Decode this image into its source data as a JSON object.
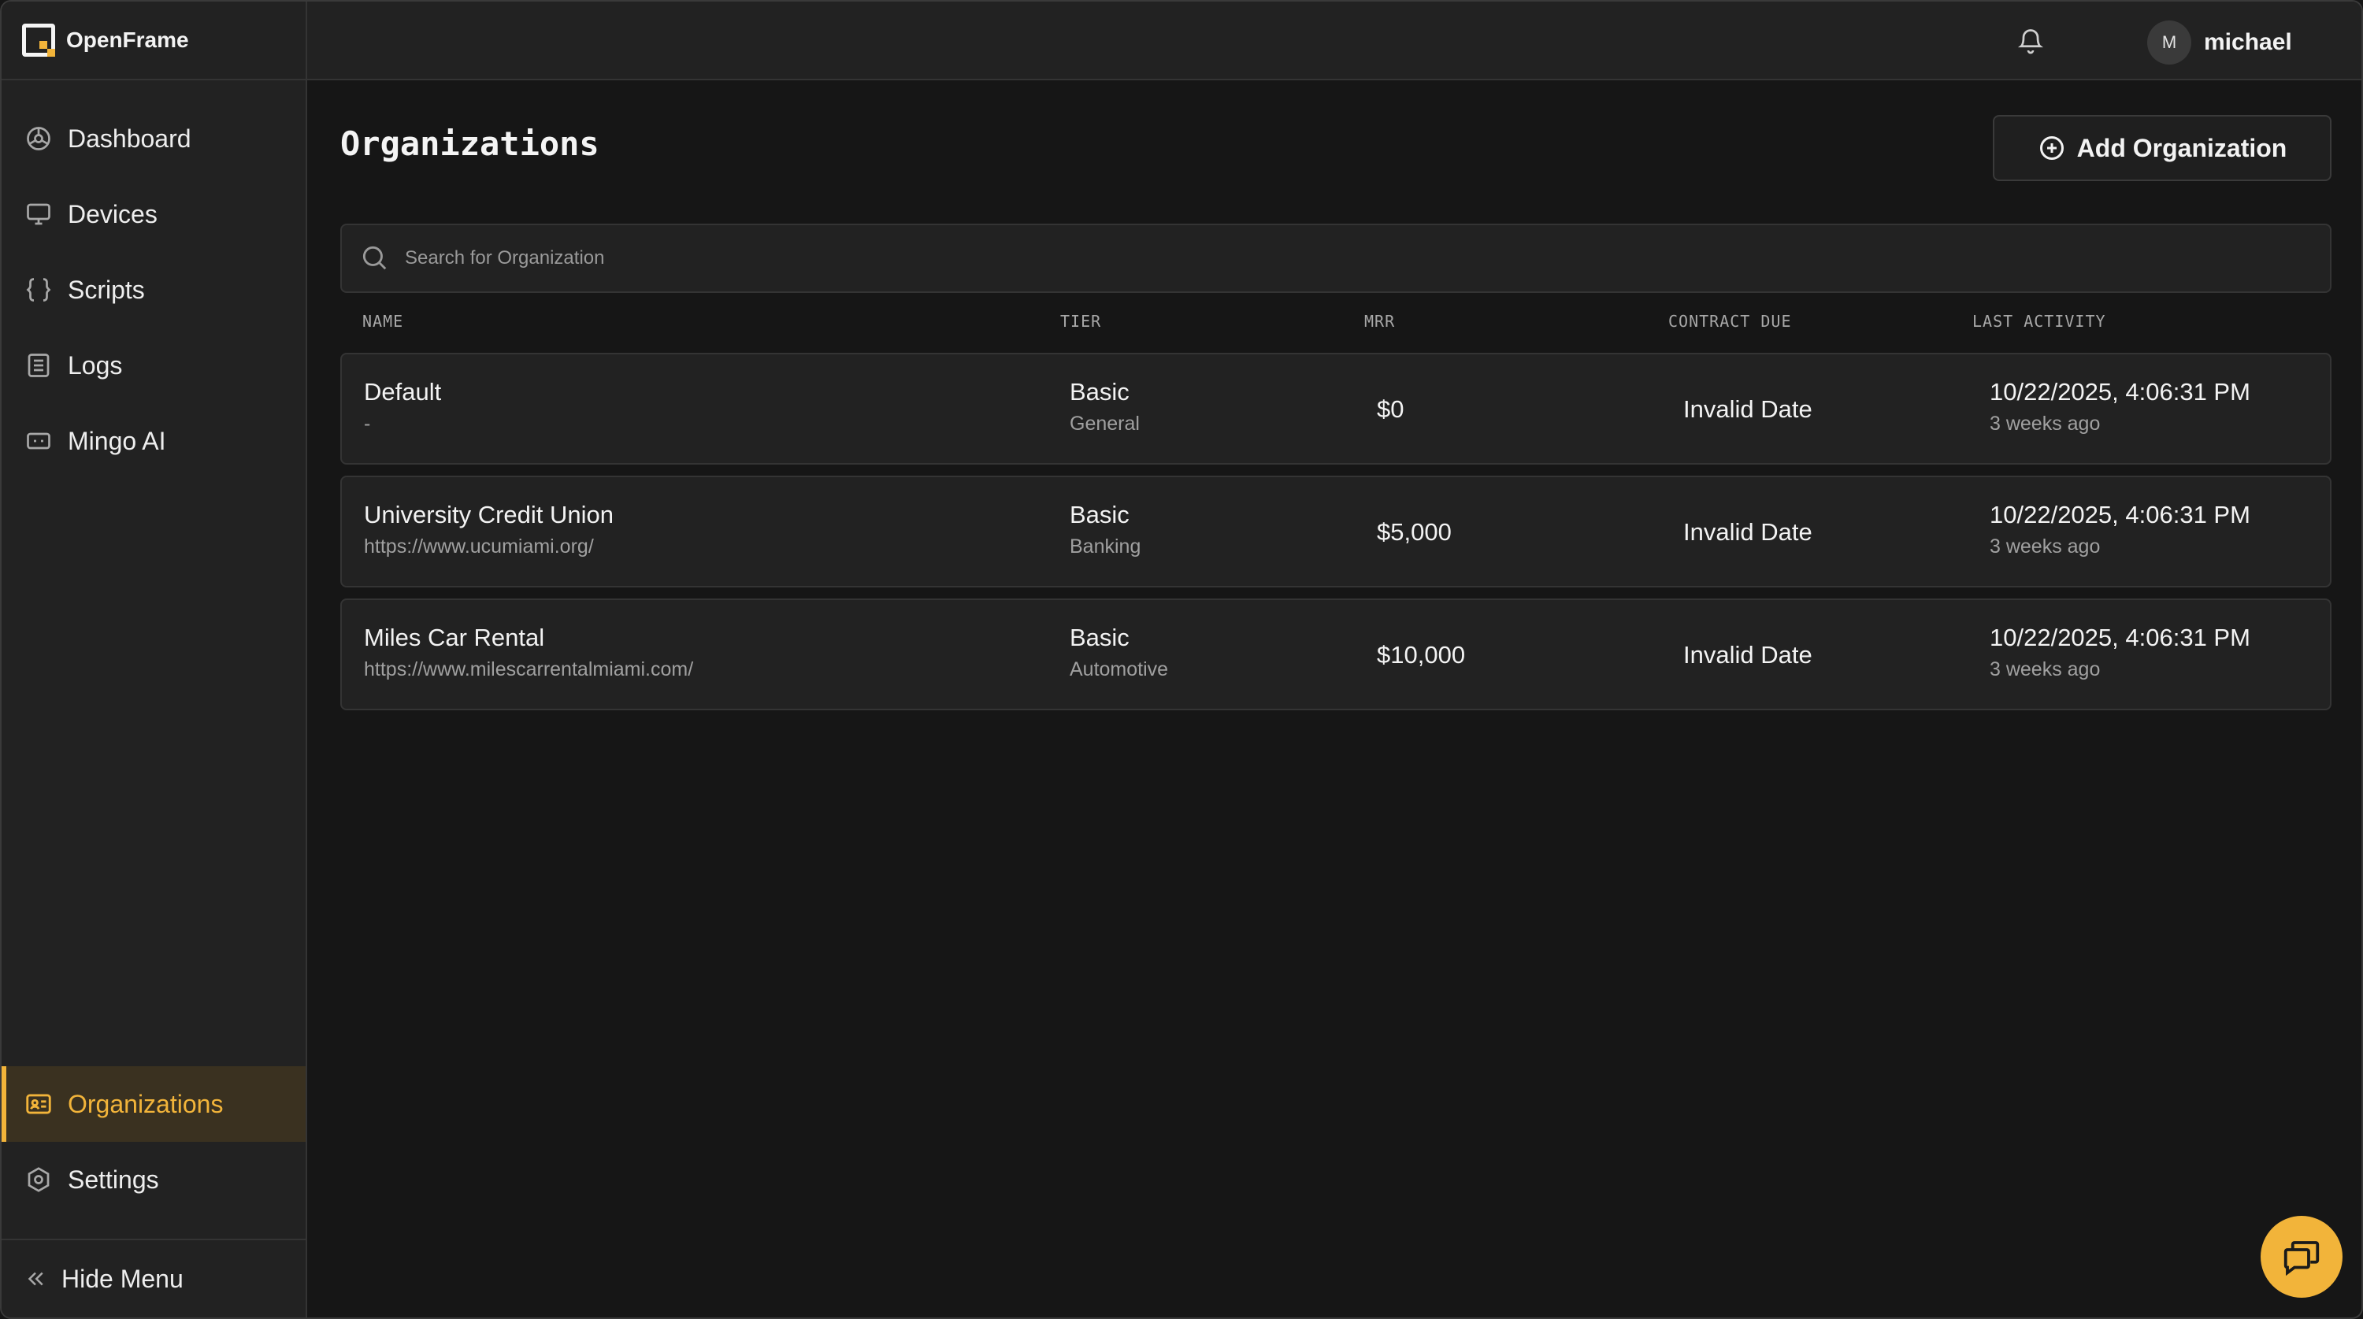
{
  "brand": {
    "name": "OpenFrame"
  },
  "colors": {
    "accent": "#f2b43a",
    "background": "#161616",
    "panel": "#222222"
  },
  "sidebar": {
    "items": [
      {
        "label": "Dashboard",
        "icon": "dashboard-icon"
      },
      {
        "label": "Devices",
        "icon": "monitor-icon"
      },
      {
        "label": "Scripts",
        "icon": "braces-icon"
      },
      {
        "label": "Logs",
        "icon": "logs-icon"
      },
      {
        "label": "Mingo AI",
        "icon": "ai-icon"
      }
    ],
    "bottom_items": [
      {
        "label": "Organizations",
        "icon": "id-card-icon",
        "active": true
      },
      {
        "label": "Settings",
        "icon": "gear-icon",
        "active": false
      }
    ],
    "hide_menu_label": "Hide Menu"
  },
  "header": {
    "user_initial": "M",
    "username": "michael"
  },
  "main": {
    "title": "Organizations",
    "add_button_label": "Add Organization",
    "search_placeholder": "Search for Organization",
    "columns": [
      "NAME",
      "TIER",
      "MRR",
      "CONTRACT DUE",
      "LAST ACTIVITY"
    ],
    "rows": [
      {
        "name": "Default",
        "url": "-",
        "tier": "Basic",
        "industry": "General",
        "mrr": "$0",
        "contract_due": "Invalid Date",
        "last_activity": "10/22/2025, 4:06:31 PM",
        "last_activity_relative": "3 weeks ago"
      },
      {
        "name": "University Credit Union",
        "url": "https://www.ucumiami.org/",
        "tier": "Basic",
        "industry": "Banking",
        "mrr": "$5,000",
        "contract_due": "Invalid Date",
        "last_activity": "10/22/2025, 4:06:31 PM",
        "last_activity_relative": "3 weeks ago"
      },
      {
        "name": "Miles Car Rental",
        "url": "https://www.milescarrentalmiami.com/",
        "tier": "Basic",
        "industry": "Automotive",
        "mrr": "$10,000",
        "contract_due": "Invalid Date",
        "last_activity": "10/22/2025, 4:06:31 PM",
        "last_activity_relative": "3 weeks ago"
      }
    ]
  }
}
